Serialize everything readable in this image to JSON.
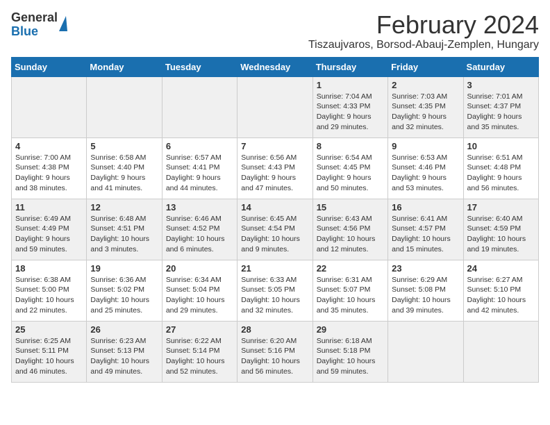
{
  "header": {
    "logo_general": "General",
    "logo_blue": "Blue",
    "month_title": "February 2024",
    "location": "Tiszaujvaros, Borsod-Abauj-Zemplen, Hungary"
  },
  "weekdays": [
    "Sunday",
    "Monday",
    "Tuesday",
    "Wednesday",
    "Thursday",
    "Friday",
    "Saturday"
  ],
  "weeks": [
    [
      {
        "day": "",
        "info": ""
      },
      {
        "day": "",
        "info": ""
      },
      {
        "day": "",
        "info": ""
      },
      {
        "day": "",
        "info": ""
      },
      {
        "day": "1",
        "info": "Sunrise: 7:04 AM\nSunset: 4:33 PM\nDaylight: 9 hours\nand 29 minutes."
      },
      {
        "day": "2",
        "info": "Sunrise: 7:03 AM\nSunset: 4:35 PM\nDaylight: 9 hours\nand 32 minutes."
      },
      {
        "day": "3",
        "info": "Sunrise: 7:01 AM\nSunset: 4:37 PM\nDaylight: 9 hours\nand 35 minutes."
      }
    ],
    [
      {
        "day": "4",
        "info": "Sunrise: 7:00 AM\nSunset: 4:38 PM\nDaylight: 9 hours\nand 38 minutes."
      },
      {
        "day": "5",
        "info": "Sunrise: 6:58 AM\nSunset: 4:40 PM\nDaylight: 9 hours\nand 41 minutes."
      },
      {
        "day": "6",
        "info": "Sunrise: 6:57 AM\nSunset: 4:41 PM\nDaylight: 9 hours\nand 44 minutes."
      },
      {
        "day": "7",
        "info": "Sunrise: 6:56 AM\nSunset: 4:43 PM\nDaylight: 9 hours\nand 47 minutes."
      },
      {
        "day": "8",
        "info": "Sunrise: 6:54 AM\nSunset: 4:45 PM\nDaylight: 9 hours\nand 50 minutes."
      },
      {
        "day": "9",
        "info": "Sunrise: 6:53 AM\nSunset: 4:46 PM\nDaylight: 9 hours\nand 53 minutes."
      },
      {
        "day": "10",
        "info": "Sunrise: 6:51 AM\nSunset: 4:48 PM\nDaylight: 9 hours\nand 56 minutes."
      }
    ],
    [
      {
        "day": "11",
        "info": "Sunrise: 6:49 AM\nSunset: 4:49 PM\nDaylight: 9 hours\nand 59 minutes."
      },
      {
        "day": "12",
        "info": "Sunrise: 6:48 AM\nSunset: 4:51 PM\nDaylight: 10 hours\nand 3 minutes."
      },
      {
        "day": "13",
        "info": "Sunrise: 6:46 AM\nSunset: 4:52 PM\nDaylight: 10 hours\nand 6 minutes."
      },
      {
        "day": "14",
        "info": "Sunrise: 6:45 AM\nSunset: 4:54 PM\nDaylight: 10 hours\nand 9 minutes."
      },
      {
        "day": "15",
        "info": "Sunrise: 6:43 AM\nSunset: 4:56 PM\nDaylight: 10 hours\nand 12 minutes."
      },
      {
        "day": "16",
        "info": "Sunrise: 6:41 AM\nSunset: 4:57 PM\nDaylight: 10 hours\nand 15 minutes."
      },
      {
        "day": "17",
        "info": "Sunrise: 6:40 AM\nSunset: 4:59 PM\nDaylight: 10 hours\nand 19 minutes."
      }
    ],
    [
      {
        "day": "18",
        "info": "Sunrise: 6:38 AM\nSunset: 5:00 PM\nDaylight: 10 hours\nand 22 minutes."
      },
      {
        "day": "19",
        "info": "Sunrise: 6:36 AM\nSunset: 5:02 PM\nDaylight: 10 hours\nand 25 minutes."
      },
      {
        "day": "20",
        "info": "Sunrise: 6:34 AM\nSunset: 5:04 PM\nDaylight: 10 hours\nand 29 minutes."
      },
      {
        "day": "21",
        "info": "Sunrise: 6:33 AM\nSunset: 5:05 PM\nDaylight: 10 hours\nand 32 minutes."
      },
      {
        "day": "22",
        "info": "Sunrise: 6:31 AM\nSunset: 5:07 PM\nDaylight: 10 hours\nand 35 minutes."
      },
      {
        "day": "23",
        "info": "Sunrise: 6:29 AM\nSunset: 5:08 PM\nDaylight: 10 hours\nand 39 minutes."
      },
      {
        "day": "24",
        "info": "Sunrise: 6:27 AM\nSunset: 5:10 PM\nDaylight: 10 hours\nand 42 minutes."
      }
    ],
    [
      {
        "day": "25",
        "info": "Sunrise: 6:25 AM\nSunset: 5:11 PM\nDaylight: 10 hours\nand 46 minutes."
      },
      {
        "day": "26",
        "info": "Sunrise: 6:23 AM\nSunset: 5:13 PM\nDaylight: 10 hours\nand 49 minutes."
      },
      {
        "day": "27",
        "info": "Sunrise: 6:22 AM\nSunset: 5:14 PM\nDaylight: 10 hours\nand 52 minutes."
      },
      {
        "day": "28",
        "info": "Sunrise: 6:20 AM\nSunset: 5:16 PM\nDaylight: 10 hours\nand 56 minutes."
      },
      {
        "day": "29",
        "info": "Sunrise: 6:18 AM\nSunset: 5:18 PM\nDaylight: 10 hours\nand 59 minutes."
      },
      {
        "day": "",
        "info": ""
      },
      {
        "day": "",
        "info": ""
      }
    ]
  ],
  "colors": {
    "header_bg": "#1a6faf",
    "shaded_row": "#f0f0f0",
    "white_row": "#ffffff"
  }
}
